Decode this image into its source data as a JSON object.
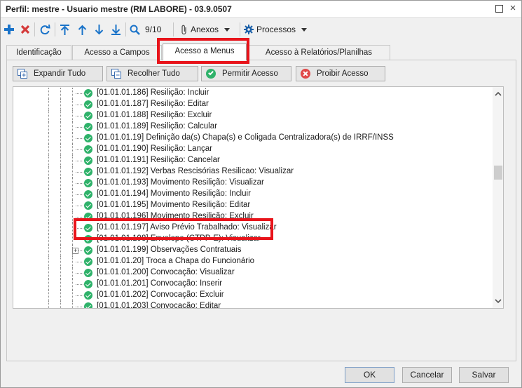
{
  "window": {
    "title": "Perfil: mestre - Usuario mestre (RM LABORE) - 03.9.0507"
  },
  "toolbar": {
    "record_position": "9/10",
    "attachments_label": "Anexos",
    "processes_label": "Processos"
  },
  "tabs": [
    {
      "label": "Identificação"
    },
    {
      "label": "Acesso a Campos"
    },
    {
      "label": "Acesso a Menus"
    },
    {
      "label": "Acesso à Relatórios/Planilhas"
    }
  ],
  "panel_buttons": {
    "expand_all": "Expandir Tudo",
    "collapse_all": "Recolher Tudo",
    "allow_access": "Permitir Acesso",
    "deny_access": "Proibir Acesso"
  },
  "tree_items": [
    {
      "label": "[01.01.01.186] Resilição: Incluir"
    },
    {
      "label": "[01.01.01.187] Resilição: Editar"
    },
    {
      "label": "[01.01.01.188] Resilição: Excluir"
    },
    {
      "label": "[01.01.01.189] Resilição: Calcular"
    },
    {
      "label": "[01.01.01.19] Definição da(s) Chapa(s) e Coligada Centralizadora(s) de IRRF/INSS"
    },
    {
      "label": "[01.01.01.190] Resilição: Lançar"
    },
    {
      "label": "[01.01.01.191] Resilição: Cancelar"
    },
    {
      "label": "[01.01.01.192] Verbas Rescisórias Resilicao: Visualizar"
    },
    {
      "label": "[01.01.01.193] Movimento Resilição: Visualizar"
    },
    {
      "label": "[01.01.01.194] Movimento Resilição: Incluir"
    },
    {
      "label": "[01.01.01.195] Movimento Resilição: Editar"
    },
    {
      "label": "[01.01.01.196] Movimento Resilição: Excluir"
    },
    {
      "label": "[01.01.01.197] Aviso Prévio Trabalhado: Visualizar"
    },
    {
      "label": "[01.01.01.198] Envelope (CTPP-E): Visualizar"
    },
    {
      "label": "[01.01.01.199] Observações Contratuais"
    },
    {
      "label": "[01.01.01.20] Troca a Chapa do Funcionário"
    },
    {
      "label": "[01.01.01.200] Convocação: Visualizar"
    },
    {
      "label": "[01.01.01.201] Convocação: Inserir"
    },
    {
      "label": "[01.01.01.202] Convocação: Excluir"
    },
    {
      "label": "[01.01.01.203] Convocação: Editar"
    }
  ],
  "footer": {
    "ok": "OK",
    "cancel": "Cancelar",
    "save": "Salvar"
  },
  "colors": {
    "highlight": "#e8141b",
    "check_green": "#2fb26a",
    "add_blue": "#1a73c9",
    "delete_red": "#d43a3a"
  }
}
